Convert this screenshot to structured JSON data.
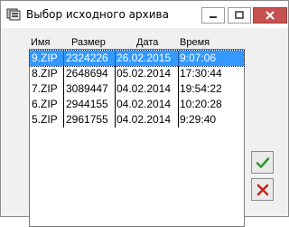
{
  "window": {
    "title": "Выбор исходного архива"
  },
  "columns": {
    "name": "Имя",
    "size": "Размер",
    "date": "Дата",
    "time": "Время"
  },
  "files": [
    {
      "name": "9.ZIP",
      "size": "2324226",
      "date": "26.02.2015",
      "time": "9:07:06",
      "selected": true
    },
    {
      "name": "8.ZIP",
      "size": "2648694",
      "date": "05.02.2014",
      "time": "17:30:44",
      "selected": false
    },
    {
      "name": "7.ZIP",
      "size": "3089447",
      "date": "04.02.2014",
      "time": "19:54:22",
      "selected": false
    },
    {
      "name": "6.ZIP",
      "size": "2944155",
      "date": "04.02.2014",
      "time": "10:20:28",
      "selected": false
    },
    {
      "name": "5.ZIP",
      "size": "2961755",
      "date": "04.02.2014",
      "time": "9:29:40",
      "selected": false
    }
  ],
  "buttons": {
    "ok_icon": "checkmark-icon",
    "cancel_icon": "cross-icon"
  },
  "colors": {
    "selection": "#3399ff",
    "ok_green": "#2e9a2e",
    "cancel_red": "#c0281e"
  }
}
